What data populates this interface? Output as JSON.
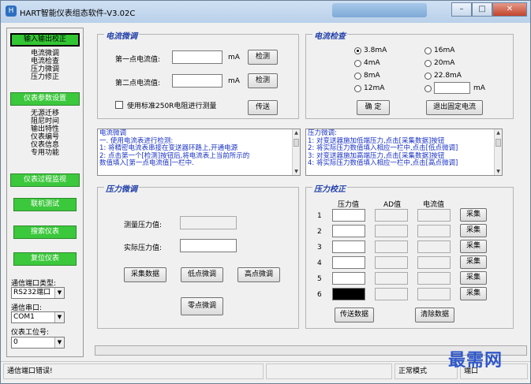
{
  "window": {
    "title": "HART智能仪表组态软件-V3.02C",
    "icon": "app-logo-icon",
    "controls": {
      "minimize": "–",
      "maximize": "□",
      "close": "✕"
    }
  },
  "nav": {
    "btn_input_output": "输入输出校正",
    "io_items": [
      "电流微调",
      "电流检查",
      "压力微调",
      "压力修正"
    ],
    "btn_params": "仪表参数设置",
    "param_items": [
      "无源迁移",
      "阻尼时间",
      "输出特性",
      "仪表编号",
      "仪表信息",
      "专用功能"
    ],
    "btn_monitor": "仪表过程监视",
    "btn_online": "联机测试",
    "btn_search": "搜索仪表",
    "btn_reset": "复位仪表",
    "port_type_label": "通信端口类型:",
    "port_type_value": "RS232端口",
    "port_label": "通信串口:",
    "port_value": "COM1",
    "station_label": "仪表工位号:",
    "station_value": "0"
  },
  "current_trim": {
    "title": "电流微调",
    "first_label": "第一点电流值:",
    "first_unit": "mA",
    "first_btn": "检测",
    "second_label": "第二点电流值:",
    "second_unit": "mA",
    "second_btn": "检测",
    "checkbox_label": "使用标准250R电阻进行测量",
    "send_btn": "传送"
  },
  "current_check": {
    "title": "电流检查",
    "options": [
      "3.8mA",
      "16mA",
      "4mA",
      "20mA",
      "8mA",
      "22.8mA",
      "12mA"
    ],
    "custom_unit": "mA",
    "confirm_btn": "确 定",
    "exit_btn": "退出固定电流"
  },
  "help_current": {
    "lines": [
      "电流微调",
      "一. 使用电流表进行检测:",
      "  1: 将精密电流表串接在变送器环路上,开通电源",
      "  2: 点击第一个[检测]按钮后,将电流表上当前所示的",
      "     数值填入[第一点电流值]一栏中."
    ]
  },
  "help_pressure": {
    "lines": [
      "压力微调:",
      "1: 对变送器施加低端压力,点击[采集数据]按钮",
      "2: 将实际压力数值填入相应一栏中,点击[低点微调]",
      "3: 对变送器施加高端压力,点击[采集数据]按钮",
      "4: 将实际压力数值填入相应一栏中,点击[高点微调]"
    ]
  },
  "pressure_trim": {
    "title": "压力微调",
    "measured_label": "测量压力值:",
    "actual_label": "实际压力值:",
    "collect_btn": "采集数据",
    "low_btn": "低点微调",
    "high_btn": "高点微调",
    "zero_btn": "零点微调"
  },
  "pressure_correct": {
    "title": "压力校正",
    "col_pressure": "压力值",
    "col_ad": "AD值",
    "col_current": "电流值",
    "rows": [
      "1",
      "2",
      "3",
      "4",
      "5",
      "6"
    ],
    "collect_label": "采集",
    "send_btn": "传送数据",
    "clear_btn": "清除数据"
  },
  "status": {
    "message": "通信端口错误!",
    "mode": "正常模式",
    "extra": "端口"
  },
  "watermark": "最需网"
}
